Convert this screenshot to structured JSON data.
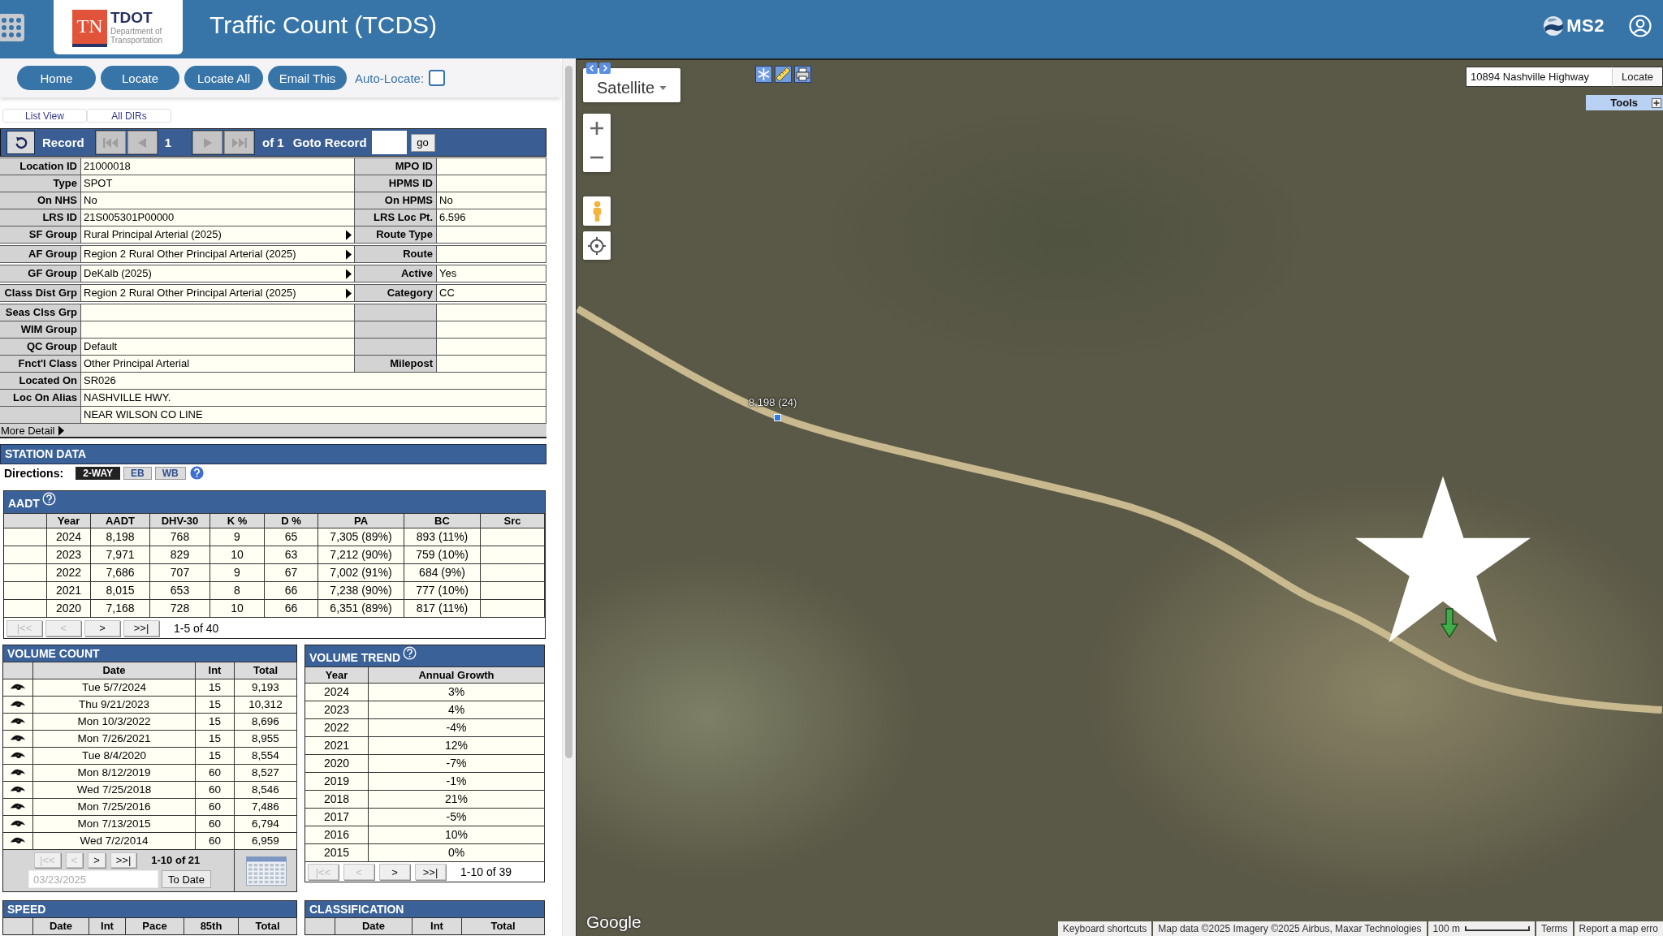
{
  "header": {
    "logo": {
      "badge": "TN",
      "name": "TDOT",
      "subtitle_1": "Department of",
      "subtitle_2": "Transportation"
    },
    "title": "Traffic Count (TCDS)",
    "brand": "MS2"
  },
  "toolbar": {
    "buttons": [
      "Home",
      "Locate",
      "Locate All",
      "Email This"
    ],
    "auto_locate": {
      "label": "Auto-Locate:",
      "checked": false
    }
  },
  "view_links": [
    "List View",
    "All DIRs"
  ],
  "record_nav": {
    "label": "Record",
    "back_buttons": [
      {
        "kind": "first",
        "disabled": true
      },
      {
        "kind": "prev",
        "disabled": true
      }
    ],
    "current": "1",
    "forward_buttons": [
      {
        "kind": "next",
        "disabled": true
      },
      {
        "kind": "last",
        "disabled": true
      }
    ],
    "total": "of 1",
    "goto_label": "Goto Record",
    "go_button": "go"
  },
  "location": {
    "rows": [
      {
        "kind": "split",
        "label": "Location ID",
        "value": "21000018",
        "expandable": false,
        "right_label": "MPO ID"
      },
      {
        "kind": "split",
        "label": "Type",
        "value": "SPOT",
        "expandable": false,
        "right_label": "HPMS ID"
      },
      {
        "kind": "split",
        "label": "On NHS",
        "value": "No",
        "expandable": false,
        "right_label": "On HPMS",
        "right_value": "No"
      },
      {
        "kind": "split",
        "label": "LRS ID",
        "value": "21S005301P00000",
        "expandable": false,
        "right_label": "LRS Loc Pt.",
        "right_value": "6.596"
      },
      {
        "kind": "split",
        "label": "SF Group",
        "value": "Rural Principal Arterial (2025)",
        "expandable": true,
        "right_label": "Route Type"
      },
      {
        "kind": "split",
        "label": "AF Group",
        "value": "Region 2 Rural Other Principal Arterial (2025)",
        "expandable": true,
        "right_label": "Route"
      },
      {
        "kind": "split",
        "label": "GF Group",
        "value": "DeKalb (2025)",
        "expandable": true,
        "right_label": "Active",
        "right_value": "Yes"
      },
      {
        "kind": "split",
        "label": "Class Dist Grp",
        "value": "Region 2 Rural Other Principal Arterial (2025)",
        "expandable": true,
        "right_label": "Category",
        "right_value": "CC"
      },
      {
        "kind": "split",
        "label": "Seas Clss Grp",
        "expandable": false
      },
      {
        "kind": "split",
        "label": "WIM Group",
        "expandable": false
      },
      {
        "kind": "split",
        "label": "QC Group",
        "value": "Default",
        "expandable": false
      },
      {
        "kind": "split",
        "label": "Fnct'l Class",
        "value": "Other Principal Arterial",
        "expandable": false,
        "right_label": "Milepost"
      },
      {
        "kind": "wide",
        "label": "Located On",
        "value": "SR026",
        "expandable": false
      },
      {
        "kind": "wide",
        "label": "Loc On Alias",
        "value": "NASHVILLE HWY.",
        "expandable": false
      },
      {
        "kind": "wide",
        "value": "NEAR WILSON CO LINE",
        "expandable": false
      }
    ],
    "more_detail": "More Detail"
  },
  "station_data": {
    "title": "STATION DATA",
    "directions": {
      "label": "Directions:",
      "options": [
        {
          "label": "2-WAY",
          "selected": true
        },
        {
          "label": "EB",
          "selected": false
        },
        {
          "label": "WB",
          "selected": false
        }
      ]
    }
  },
  "aadt": {
    "title": "AADT",
    "columns": [
      "Year",
      "AADT",
      "DHV-30",
      "K %",
      "D %",
      "PA",
      "BC",
      "Src"
    ],
    "rows": [
      [
        "2024",
        "8,198",
        "768",
        "9",
        "65",
        "7,305 (89%)",
        "893 (11%)"
      ],
      [
        "2023",
        "7,971",
        "829",
        "10",
        "63",
        "7,212 (90%)",
        "759 (10%)"
      ],
      [
        "2022",
        "7,686",
        "707",
        "9",
        "67",
        "7,002 (91%)",
        "684 (9%)"
      ],
      [
        "2021",
        "8,015",
        "653",
        "8",
        "66",
        "7,238 (90%)",
        "777 (10%)"
      ],
      [
        "2020",
        "7,168",
        "728",
        "10",
        "66",
        "6,351 (89%)",
        "817 (11%)"
      ]
    ],
    "pager": {
      "buttons": [
        {
          "label": "|<<",
          "disabled": true
        },
        {
          "label": "<",
          "disabled": true
        },
        {
          "label": ">",
          "disabled": false
        },
        {
          "label": ">>|",
          "disabled": false
        }
      ],
      "range": "1-5 of 40"
    }
  },
  "volume_count": {
    "title": "VOLUME COUNT",
    "columns": [
      "Date",
      "Int",
      "Total"
    ],
    "rows": [
      [
        "Tue 5/7/2024",
        "15",
        "9,193"
      ],
      [
        "Thu 9/21/2023",
        "15",
        "10,312"
      ],
      [
        "Mon 10/3/2022",
        "15",
        "8,696"
      ],
      [
        "Mon 7/26/2021",
        "15",
        "8,955"
      ],
      [
        "Tue 8/4/2020",
        "15",
        "8,554"
      ],
      [
        "Mon 8/12/2019",
        "60",
        "8,527"
      ],
      [
        "Wed 7/25/2018",
        "60",
        "8,546"
      ],
      [
        "Mon 7/25/2016",
        "60",
        "7,486"
      ],
      [
        "Mon 7/13/2015",
        "60",
        "6,794"
      ],
      [
        "Wed 7/2/2014",
        "60",
        "6,959"
      ]
    ],
    "pager": {
      "buttons": [
        {
          "label": "|<<",
          "disabled": true
        },
        {
          "label": "<",
          "disabled": true
        },
        {
          "label": ">",
          "disabled": false
        },
        {
          "label": ">>|",
          "disabled": false
        }
      ],
      "range": "1-10 of 21"
    },
    "date_field": {
      "placeholder": "03/23/2025"
    },
    "to_date_button": "To Date"
  },
  "volume_trend": {
    "title": "VOLUME TREND",
    "columns": [
      "Year",
      "Annual Growth"
    ],
    "rows": [
      [
        "2024",
        "3%"
      ],
      [
        "2023",
        "4%"
      ],
      [
        "2022",
        "-4%"
      ],
      [
        "2021",
        "12%"
      ],
      [
        "2020",
        "-7%"
      ],
      [
        "2019",
        "-1%"
      ],
      [
        "2018",
        "21%"
      ],
      [
        "2017",
        "-5%"
      ],
      [
        "2016",
        "10%"
      ],
      [
        "2015",
        "0%"
      ]
    ],
    "pager": {
      "buttons": [
        {
          "label": "|<<",
          "disabled": true
        },
        {
          "label": "<",
          "disabled": true
        },
        {
          "label": ">",
          "disabled": false
        },
        {
          "label": ">>|",
          "disabled": false
        }
      ],
      "range": "1-10 of 39"
    }
  },
  "speed": {
    "title": "SPEED",
    "columns": [
      "Date",
      "Int",
      "Pace",
      "85th",
      "Total"
    ]
  },
  "classification": {
    "title": "CLASSIFICATION",
    "columns": [
      "Date",
      "Int",
      "Total"
    ]
  },
  "map": {
    "map_type": "Satellite",
    "address_field": {
      "value": "10894 Nashville Highway"
    },
    "locate_button": "Locate",
    "tools_label": "Tools",
    "station_label": "8,198 (24)",
    "logo": "Google",
    "footer": [
      {
        "kind": "link",
        "text": "Keyboard shortcuts"
      },
      {
        "kind": "text",
        "text": "Map data ©2025 Imagery ©2025 Airbus, Maxar Technologies"
      },
      {
        "kind": "scale",
        "text": "100 m"
      },
      {
        "kind": "link",
        "text": "Terms"
      },
      {
        "kind": "link",
        "text": "Report a map erro"
      }
    ]
  }
}
